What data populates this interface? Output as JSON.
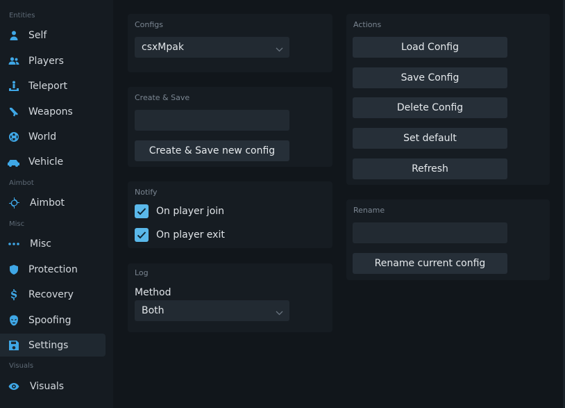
{
  "sidebar": {
    "sections": {
      "entities": "Entities",
      "aimbot": "Aimbot",
      "misc": "Misc",
      "visuals": "Visuals"
    },
    "items": [
      {
        "label": "Self",
        "icon": "user-icon"
      },
      {
        "label": "Players",
        "icon": "users-icon"
      },
      {
        "label": "Teleport",
        "icon": "teleport-icon"
      },
      {
        "label": "Weapons",
        "icon": "gun-icon"
      },
      {
        "label": "World",
        "icon": "globe-icon"
      },
      {
        "label": "Vehicle",
        "icon": "car-icon"
      },
      {
        "label": "Aimbot",
        "icon": "crosshair-icon"
      },
      {
        "label": "Misc",
        "icon": "dots-icon"
      },
      {
        "label": "Protection",
        "icon": "shield-icon"
      },
      {
        "label": "Recovery",
        "icon": "dollar-icon"
      },
      {
        "label": "Spoofing",
        "icon": "mask-icon"
      },
      {
        "label": "Settings",
        "icon": "save-icon",
        "active": true
      },
      {
        "label": "Visuals",
        "icon": "eye-icon"
      }
    ]
  },
  "configs": {
    "title": "Configs",
    "selected": "csxMpak"
  },
  "create_save": {
    "title": "Create & Save",
    "input_value": "",
    "button_label": "Create & Save new config"
  },
  "notify": {
    "title": "Notify",
    "options": [
      {
        "label": "On player join",
        "checked": true
      },
      {
        "label": "On player exit",
        "checked": true
      }
    ]
  },
  "log": {
    "title": "Log",
    "method_label": "Method",
    "method_value": "Both"
  },
  "actions": {
    "title": "Actions",
    "buttons": [
      "Load Config",
      "Save Config",
      "Delete Config",
      "Set default",
      "Refresh"
    ]
  },
  "rename": {
    "title": "Rename",
    "input_value": "",
    "button_label": "Rename current config"
  },
  "colors": {
    "accent": "#3fa7e6",
    "checkbox": "#5ab8ea",
    "panel": "#161c22",
    "sidebar": "#151b21"
  }
}
